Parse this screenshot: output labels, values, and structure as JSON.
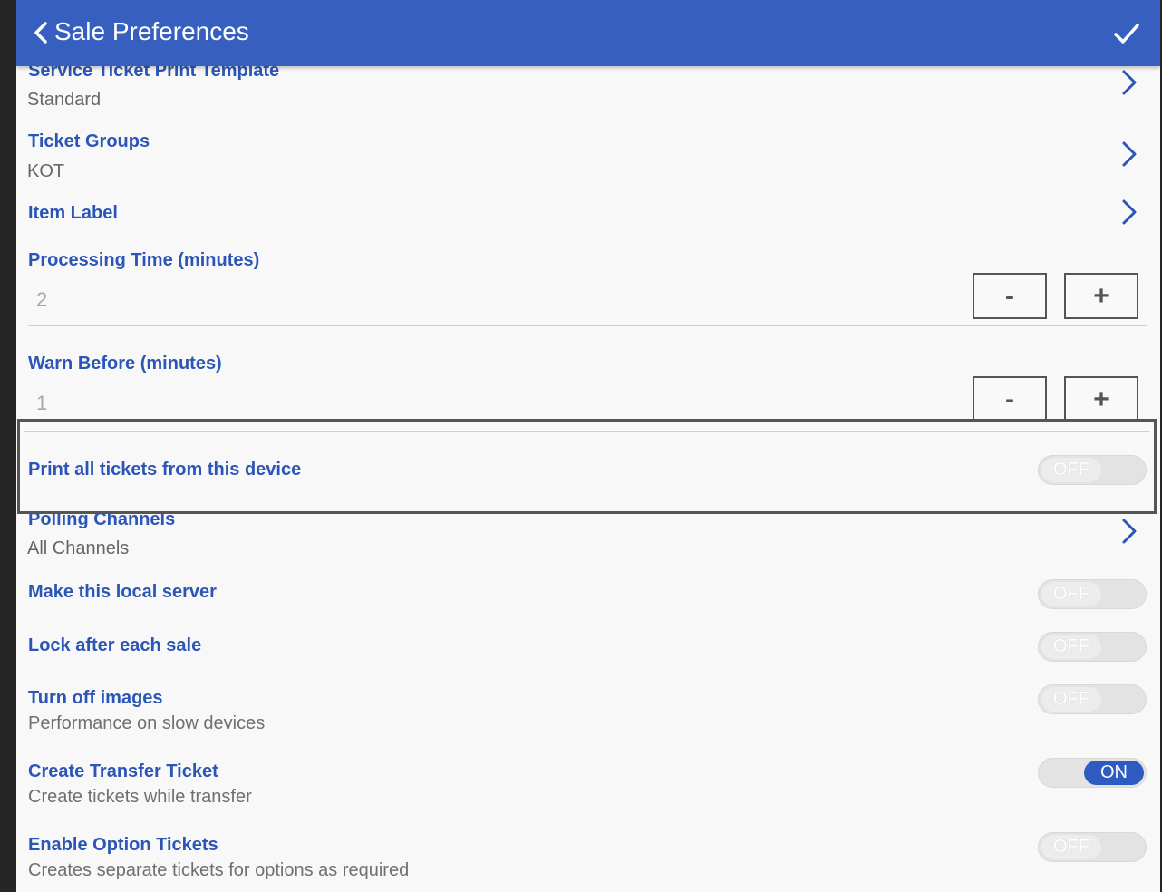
{
  "header": {
    "title": "Sale Preferences"
  },
  "settings": {
    "service_ticket_template": {
      "label": "Service Ticket Print Template",
      "value": "Standard"
    },
    "ticket_groups": {
      "label": "Ticket Groups",
      "value": "KOT"
    },
    "item_label": {
      "label": "Item Label"
    },
    "processing_time": {
      "label": "Processing Time (minutes)",
      "value": "2",
      "minus": "-",
      "plus": "+"
    },
    "warn_before": {
      "label": "Warn Before (minutes)",
      "value": "1",
      "minus": "-",
      "plus": "+"
    },
    "print_all_tickets": {
      "label": "Print all tickets from this device",
      "toggle": "OFF"
    },
    "polling_channels": {
      "label": "Polling Channels",
      "value": "All Channels"
    },
    "local_server": {
      "label": "Make this local server",
      "toggle": "OFF"
    },
    "lock_after_sale": {
      "label": "Lock after each sale",
      "toggle": "OFF"
    },
    "turn_off_images": {
      "label": "Turn off images",
      "sub": "Performance on slow devices",
      "toggle": "OFF"
    },
    "create_transfer_ticket": {
      "label": "Create Transfer Ticket",
      "sub": "Create tickets while transfer",
      "toggle": "ON"
    },
    "enable_option_tickets": {
      "label": "Enable Option Tickets",
      "sub": "Creates separate tickets for options as required",
      "toggle": "OFF"
    }
  },
  "colors": {
    "header": "#365fbf",
    "accent": "#2b56b8",
    "toggle_on": "#2d5bc2"
  }
}
